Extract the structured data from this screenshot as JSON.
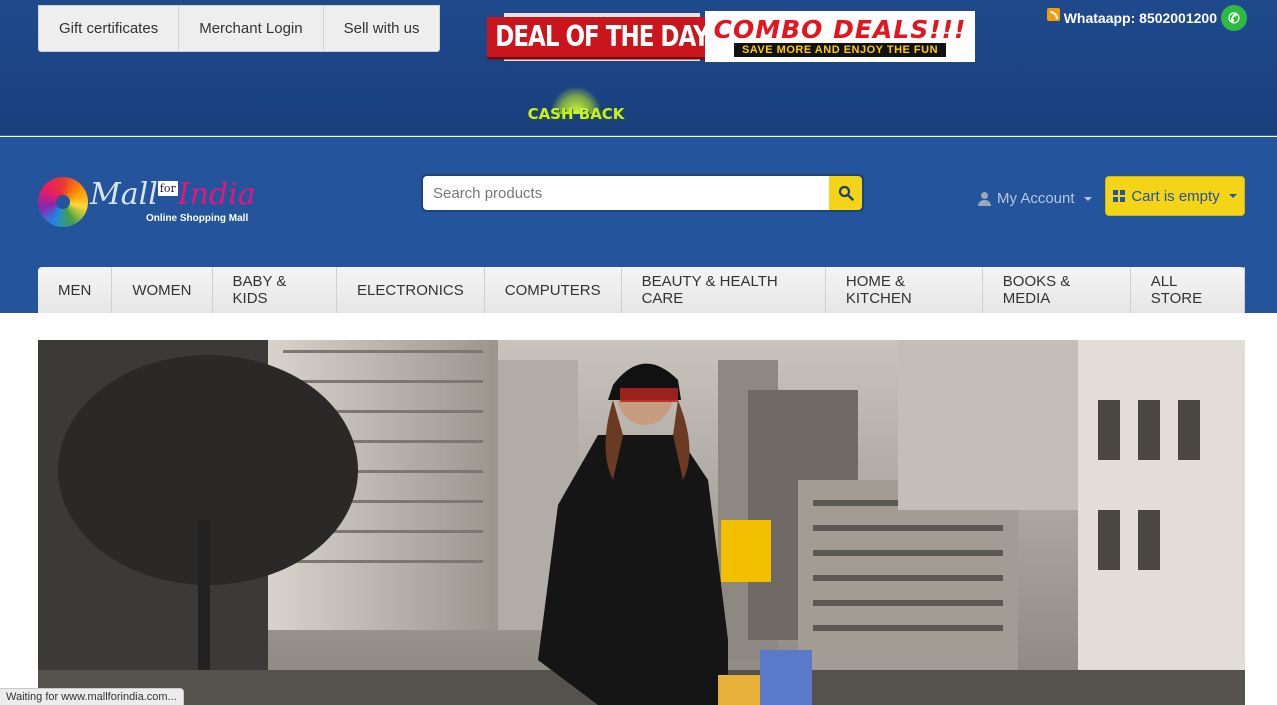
{
  "top_links": [
    "Gift certificates",
    "Merchant Login",
    "Sell with us"
  ],
  "banners": {
    "deal_of_the_day": "DEAL OF THE DAY",
    "combo_title": "COMBO DEALS!!!",
    "combo_subtitle": "SAVE MORE AND ENJOY THE FUN",
    "cashback": "CASH BACK"
  },
  "contact": {
    "whatsapp": "Whataapp: 8502001200"
  },
  "logo": {
    "mall": "Mall",
    "for": "for",
    "india": "India",
    "tagline": "Online Shopping Mall"
  },
  "search": {
    "placeholder": "Search products"
  },
  "account": {
    "label": "My Account"
  },
  "cart": {
    "label": "Cart is empty"
  },
  "nav": [
    "MEN",
    "WOMEN",
    "BABY & KIDS",
    "ELECTRONICS",
    "COMPUTERS",
    "BEAUTY & HEALTH CARE",
    "HOME & KITCHEN",
    "BOOKS & MEDIA",
    "ALL STORE"
  ],
  "status": "Waiting for www.mallforindia.com...",
  "colors": {
    "header_blue": "#24549c",
    "accent_yellow": "#f3d416",
    "deal_red": "#c9151b",
    "combo_red": "#e2161f"
  }
}
